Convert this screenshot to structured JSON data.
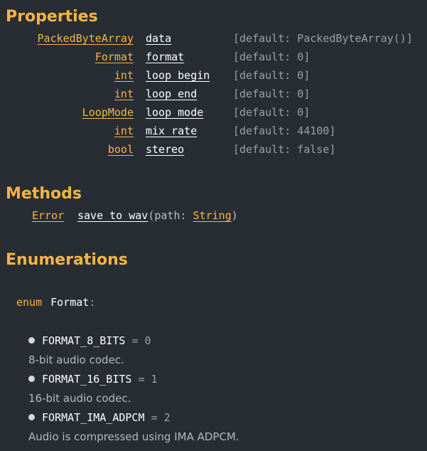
{
  "sections": {
    "properties": "Properties",
    "methods": "Methods",
    "enumerations": "Enumerations"
  },
  "properties": [
    {
      "type": "PackedByteArray",
      "name": "data",
      "default": "[default: PackedByteArray()]"
    },
    {
      "type": "Format",
      "name": "format",
      "default": "[default: 0]"
    },
    {
      "type": "int",
      "name": "loop_begin",
      "default": "[default: 0]"
    },
    {
      "type": "int",
      "name": "loop_end",
      "default": "[default: 0]"
    },
    {
      "type": "LoopMode",
      "name": "loop_mode",
      "default": "[default: 0]"
    },
    {
      "type": "int",
      "name": "mix_rate",
      "default": "[default: 44100]"
    },
    {
      "type": "bool",
      "name": "stereo",
      "default": "[default: false]"
    }
  ],
  "methods": [
    {
      "return_type": "Error",
      "name": "save_to_wav",
      "open": "(path: ",
      "param_type": "String",
      "close": ")"
    }
  ],
  "enum": {
    "keyword": "enum",
    "name": "Format",
    "colon": ":",
    "items": [
      {
        "name": "FORMAT_8_BITS",
        "value": "= 0",
        "description": "8-bit audio codec."
      },
      {
        "name": "FORMAT_16_BITS",
        "value": "= 1",
        "description": "16-bit audio codec."
      },
      {
        "name": "FORMAT_IMA_ADPCM",
        "value": "= 2",
        "description": "Audio is compressed using IMA ADPCM."
      }
    ]
  },
  "colors": {
    "background": "#282d34",
    "accent": "#f5b544",
    "text": "#ffffff",
    "muted": "#9aa0a8"
  }
}
